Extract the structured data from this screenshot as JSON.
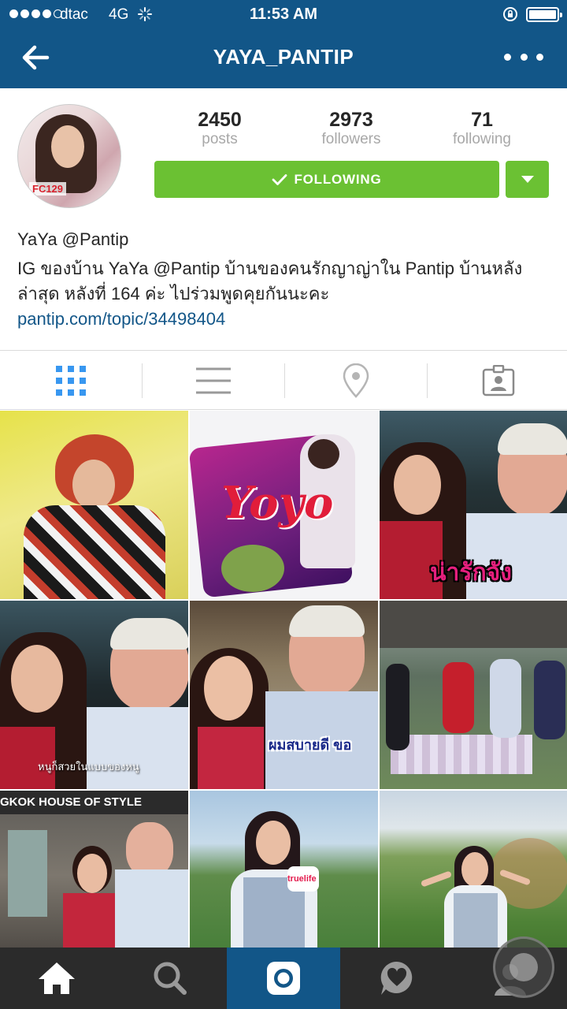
{
  "status_bar": {
    "carrier": "dtac",
    "network": "4G",
    "time": "11:53 AM"
  },
  "nav": {
    "title": "YAYA_PANTIP",
    "back_icon": "back-arrow-icon",
    "more_icon": "more-dots-icon"
  },
  "profile": {
    "avatar_badge": "FC129",
    "stats": [
      {
        "value": "2450",
        "label": "posts"
      },
      {
        "value": "2973",
        "label": "followers"
      },
      {
        "value": "71",
        "label": "following"
      }
    ],
    "follow_button_label": "FOLLOWING",
    "bio": {
      "name": "YaYa @Pantip",
      "text": "IG ของบ้าน YaYa @Pantip บ้านของคนรักญาญ่าใน Pantip บ้านหลังล่าสุด หลังที่ 164 ค่ะ ไปร่วมพูดคุยกันนะคะ",
      "link": "pantip.com/topic/34498404"
    }
  },
  "view_tabs": [
    {
      "name": "grid-view",
      "icon": "grid-icon",
      "active": true
    },
    {
      "name": "list-view",
      "icon": "list-icon",
      "active": false
    },
    {
      "name": "places-view",
      "icon": "location-pin-icon",
      "active": false
    },
    {
      "name": "tagged-view",
      "icon": "tagged-person-icon",
      "active": false
    }
  ],
  "grid": {
    "posts": [
      {
        "caption": ""
      },
      {
        "caption": "Yoyo"
      },
      {
        "caption": "น่ารักจัง"
      },
      {
        "caption": "หนูก็สวยในแบบของหนู"
      },
      {
        "caption": "ผมสบายดี ขอ"
      },
      {
        "caption": ""
      },
      {
        "caption": "GKOK HOUSE OF STYLE"
      },
      {
        "caption": "truelife"
      },
      {
        "caption": ""
      }
    ]
  },
  "bottom_bar": [
    {
      "name": "home",
      "icon": "home-icon",
      "active": false
    },
    {
      "name": "search",
      "icon": "search-icon",
      "active": false
    },
    {
      "name": "camera",
      "icon": "camera-icon",
      "active": true
    },
    {
      "name": "activity",
      "icon": "heart-bubble-icon",
      "active": false
    },
    {
      "name": "profile",
      "icon": "profile-icon",
      "active": false
    }
  ],
  "colors": {
    "brand_blue": "#125688",
    "follow_green": "#6bc133",
    "tab_bar": "#2b2b2b"
  }
}
